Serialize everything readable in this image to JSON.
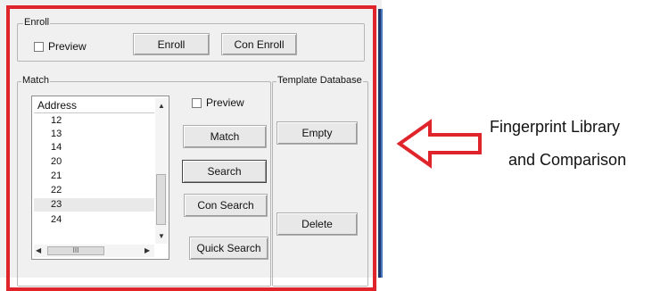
{
  "enroll": {
    "legend": "Enroll",
    "preview_label": "Preview",
    "enroll_button": "Enroll",
    "con_enroll_button": "Con Enroll"
  },
  "match": {
    "legend": "Match",
    "list_header": "Address",
    "addresses": [
      "12",
      "13",
      "14",
      "20",
      "21",
      "22",
      "23",
      "24"
    ],
    "selected_address": "23",
    "scroll_thumb_glyph": "III",
    "preview_label": "Preview",
    "match_button": "Match",
    "search_button": "Search",
    "con_search_button": "Con Search",
    "quick_search_button": "Quick Search"
  },
  "template_database": {
    "legend": "Template Database",
    "empty_button": "Empty",
    "delete_button": "Delete"
  },
  "annotation": {
    "line1": "Fingerprint Library",
    "line2": "and Comparison",
    "arrow_color": "#e0242b"
  },
  "colors": {
    "highlight_border": "#e0242b",
    "side_line_dark": "#1f3a6e",
    "side_line_blue": "#4a78c0"
  }
}
